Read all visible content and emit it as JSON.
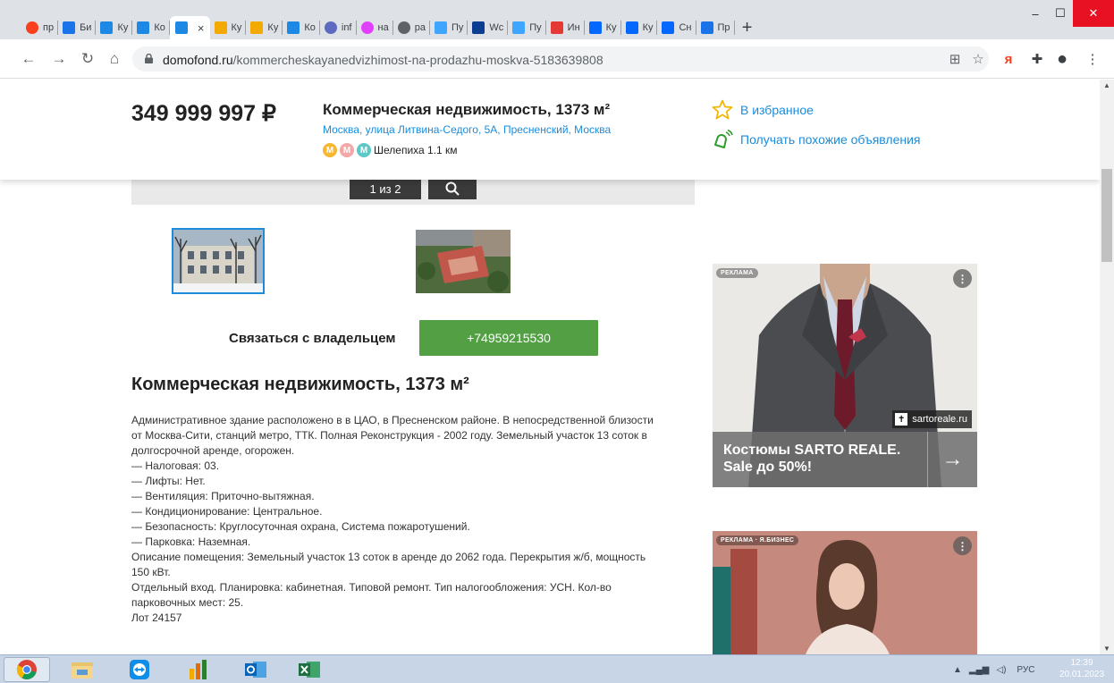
{
  "browser": {
    "tabs": [
      {
        "label": "пр",
        "icon": "yandex-icon",
        "color": "#fc3f1d"
      },
      {
        "label": "Би",
        "icon": "domofond-icon",
        "color": "#1a73e8"
      },
      {
        "label": "Ку",
        "icon": "bookmark-icon",
        "color": "#1e88e5"
      },
      {
        "label": "Ко",
        "icon": "bookmark-icon",
        "color": "#1e88e5"
      },
      {
        "label": "",
        "icon": "bookmark-icon",
        "color": "#1e88e5",
        "active": true
      },
      {
        "label": "Ку",
        "icon": "house-icon",
        "color": "#f2a900"
      },
      {
        "label": "Ку",
        "icon": "house-icon",
        "color": "#f2a900"
      },
      {
        "label": "Ко",
        "icon": "bookmark-icon",
        "color": "#1e88e5"
      },
      {
        "label": "inf",
        "icon": "info-icon",
        "color": "#5c6bc0"
      },
      {
        "label": "на",
        "icon": "ring-icon",
        "color": "#e040fb"
      },
      {
        "label": "ра",
        "icon": "globe-icon",
        "color": "#5f6368"
      },
      {
        "label": "Пу",
        "icon": "pinwheel-icon",
        "color": "#3ea6ff"
      },
      {
        "label": "Wc",
        "icon": "imf-icon",
        "color": "#0b3d91"
      },
      {
        "label": "Пу",
        "icon": "pinwheel-icon",
        "color": "#3ea6ff"
      },
      {
        "label": "Ин",
        "icon": "flag-icon",
        "color": "#e53935"
      },
      {
        "label": "Ку",
        "icon": "cian-icon",
        "color": "#0468ff"
      },
      {
        "label": "Ку",
        "icon": "cian-icon",
        "color": "#0468ff"
      },
      {
        "label": "Сн",
        "icon": "cian-icon",
        "color": "#0468ff"
      },
      {
        "label": "Пр",
        "icon": "domofond-icon",
        "color": "#1a73e8"
      }
    ],
    "new_tab": "+",
    "close_tab": "×",
    "window": {
      "minimize": "–",
      "maximize": "☐",
      "close": "✕"
    },
    "url_domain": "domofond.ru",
    "url_path": "/kommercheskayanedvizhimost-na-prodazhu-moskva-5183639808",
    "nav": {
      "back": "←",
      "forward": "→",
      "reload": "↻",
      "home": "⌂"
    },
    "toolbar_icons": {
      "translate": "⊞",
      "star": "☆",
      "yandex": "я",
      "extensions": "✚",
      "profile": "●",
      "menu": "⋮"
    }
  },
  "listing": {
    "price": "349 999 997 ₽",
    "title": "Коммерческая недвижимость, 1373 м²",
    "address": "Москва, улица Литвина-Седого, 5А, Пресненский, Москва",
    "metro": {
      "badge": "М",
      "station": "Шелепиха 1.1 км",
      "colors": [
        "#f7b731",
        "#f4a7a7",
        "#5ec8c8"
      ]
    },
    "favorite_label": "В избранное",
    "alert_label": "Получать похожие объявления",
    "gallery_counter": "1 из 2",
    "contact_label": "Связаться с владельцем",
    "phone": "+74959215530",
    "heading": "Коммерческая недвижимость, 1373 м²",
    "description": [
      "Административное здание расположено в в ЦАО, в Пресненском районе. В непосредственной близости",
      "от Москва-Сити, станций метро, ТТК. Полная Реконструкция - 2002 году. Земельный участок 13 соток в",
      "долгосрочной аренде, огорожен.",
      "— Налоговая: 03.",
      "— Лифты: Нет.",
      "— Вентиляция: Приточно-вытяжная.",
      "— Кондиционирование: Центральное.",
      "— Безопасность: Круглосуточная охрана, Система пожаротушений.",
      "— Парковка: Наземная.",
      "Описание помещения: Земельный участок 13 соток в аренде до 2062 года. Перекрытия ж/б, мощность",
      "150 кВт.",
      "Отдельный вход. Планировка: кабинетная. Типовой ремонт. Тип налогообложения: УСН. Кол-во",
      "парковочных мест: 25.",
      "Лот 24157"
    ]
  },
  "ads": [
    {
      "tag": "РЕКЛАМА",
      "domain": "sartoreale.ru",
      "text": "Костюмы SARTO REALE. Sale до 50%!",
      "arrow": "→",
      "more": "⋮"
    },
    {
      "tag": "РЕКЛАМА · Я.БИЗНЕС",
      "more": "⋮"
    }
  ],
  "taskbar": {
    "apps": [
      "chrome-icon",
      "file-explorer-icon",
      "teamviewer-icon",
      "chart-app-icon",
      "outlook-icon",
      "excel-icon"
    ],
    "tray_lang": "РУС",
    "time": "12:39",
    "date": "20.01.2023"
  },
  "colors": {
    "accent_link": "#1a8cdb",
    "phone_button": "#52a043",
    "close_button": "#e81123"
  }
}
